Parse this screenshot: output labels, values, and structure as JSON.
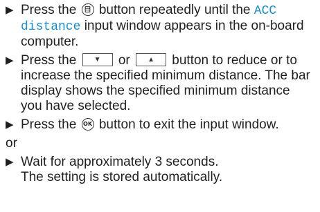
{
  "steps": [
    {
      "bullet": "▶",
      "before_icon": "Press the",
      "icon": "menu-button-icon",
      "after_icon": "button repeatedly until the",
      "highlight": "ACC distance",
      "rest": "input window appears in the on-board computer."
    },
    {
      "bullet": "▶",
      "before": "Press the",
      "down_key_icon": "down-arrow-key-icon",
      "mid": "or",
      "up_key_icon": "up-arrow-key-icon",
      "after": "button to reduce or to increase the specified minimum distance. The bar display shows the specified minimum distance you have selected."
    },
    {
      "bullet": "▶",
      "before_icon": "Press the",
      "icon": "ok-button-icon",
      "icon_label": "OK",
      "after_icon": "button to exit the input window."
    }
  ],
  "or_label": "or",
  "final_step": {
    "bullet": "▶",
    "line1": "Wait for approximately 3 seconds.",
    "line2": "The setting is stored automatically."
  }
}
